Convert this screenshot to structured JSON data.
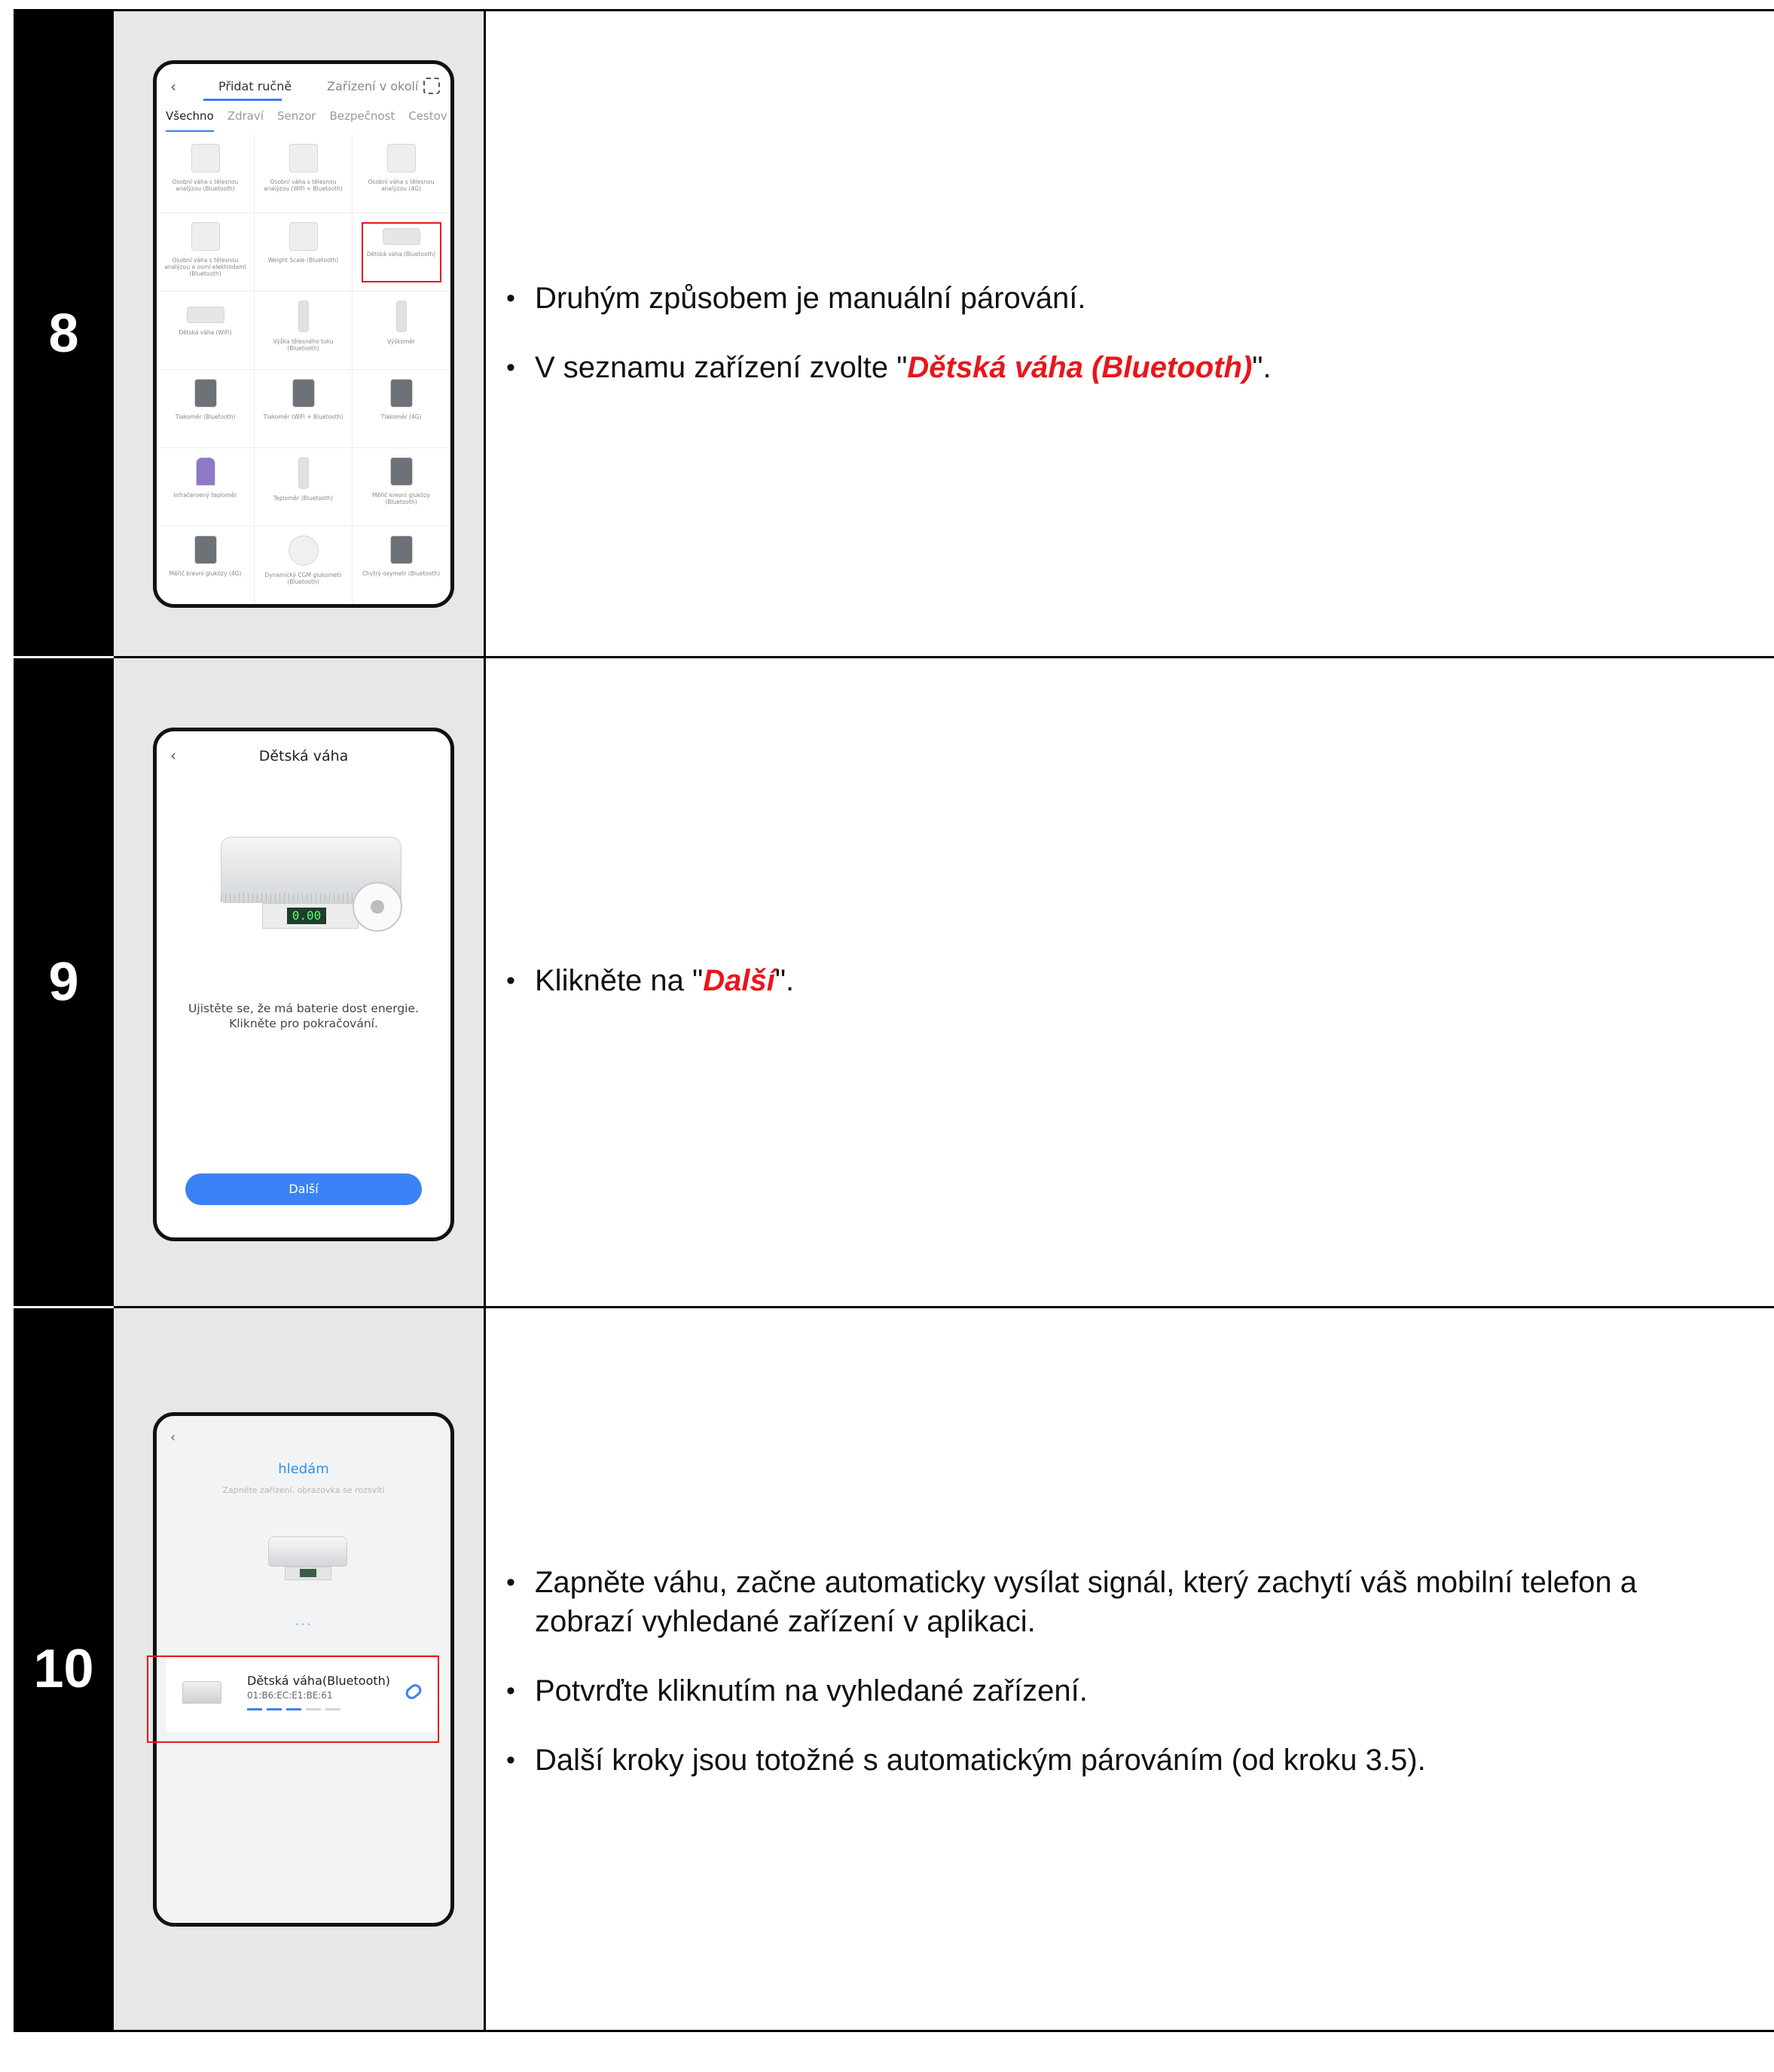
{
  "steps": [
    {
      "number": "8",
      "bullets": [
        {
          "pre": "Druhým způsobem je manuální párování.",
          "em": "",
          "post": ""
        },
        {
          "pre": "V seznamu zařízení zvolte \"",
          "em": "Dětská váha (Bluetooth)",
          "post": "\"."
        }
      ],
      "phone": {
        "tab_manual": "Přidat ručně",
        "tab_nearby": "Zařízení v okolí",
        "categories": [
          "Všechno",
          "Zdraví",
          "Senzor",
          "Bezpečnost",
          "Cestov"
        ],
        "devices": [
          "Osobní váha s tělesnou analýzou (Bluetooth)",
          "Osobní váha s tělesnou analýzou (WiFi + Bluetooth)",
          "Osobní váha s tělesnou analýzou (4G)",
          "Osobní váha s tělesnou analýzou a osmi elektrodami (Bluetooth)",
          "Weight Scale (Bluetooth)",
          "Dětská váha (Bluetooth)",
          "Dětská váha (WiFi)",
          "Výška tělesného tuku (Bluetooth)",
          "Výškoměr",
          "Tlakoměr (Bluetooth)",
          "Tlakoměr (WiFi + Bluetooth)",
          "Tlakoměr (4G)",
          "Infračervený teploměr",
          "Teploměr (Bluetooth)",
          "Měřič krevní glukózy (Bluetooth)",
          "Měřič krevní glukózy (4G)",
          "Dynamický CGM glukometr (Bluetooth)",
          "Chytrý oxymetr (Bluetooth)"
        ]
      }
    },
    {
      "number": "9",
      "bullets": [
        {
          "pre": "Klikněte na \"",
          "em": "Další",
          "post": "\"."
        }
      ],
      "phone": {
        "title": "Dětská váha",
        "display": "0.00",
        "note": "Ujistěte se, že má baterie dost energie. Klikněte pro pokračování.",
        "next_button": "Další"
      }
    },
    {
      "number": "10",
      "bullets": [
        {
          "pre": "Zapněte váhu, začne automaticky vysílat signál, který zachytí váš mobilní telefon a zobrazí vyhledané zařízení v aplikaci.",
          "em": "",
          "post": ""
        },
        {
          "pre": "Potvrďte kliknutím na vyhledané zařízení.",
          "em": "",
          "post": ""
        },
        {
          "pre": "Další kroky jsou totožné s automatickým párováním (od kroku 3.5).",
          "em": "",
          "post": ""
        }
      ],
      "phone": {
        "title": "hledám",
        "subtitle": "Zapněte zařízení, obrazovka se rozsvítí",
        "device_name": "Dětská váha(Bluetooth)",
        "device_mac": "01:B6:EC:E1:BE:61"
      }
    }
  ],
  "colors": {
    "accent": "#e8161b",
    "primary": "#3b82f6",
    "num_bg": "#000000",
    "img_bg": "#e7e7e7"
  },
  "icons": {
    "back": "chevron-left-icon",
    "scan": "scan-icon",
    "link": "link-icon"
  }
}
